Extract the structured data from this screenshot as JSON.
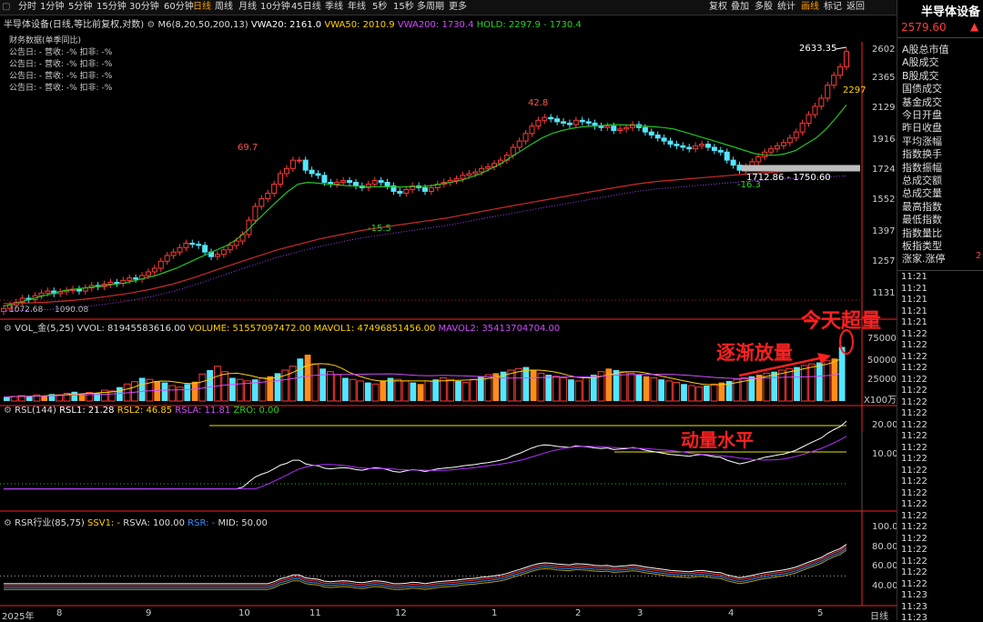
{
  "toolbar": {
    "periods": [
      "分时",
      "1分钟",
      "5分钟",
      "15分钟",
      "30分钟",
      "60分钟",
      "日线",
      "周线",
      "月线",
      "10分钟",
      "45日线",
      "季线",
      "年线",
      "5秒",
      "15秒",
      "多周期",
      "更多"
    ],
    "active_period": "日线",
    "right": [
      "复权",
      "叠加",
      "多股",
      "统计",
      "画线",
      "标记",
      "返回"
    ],
    "right_active": "画线"
  },
  "main_legend": {
    "name": "半导体设备(日线,等比前复权,对数)",
    "ind": "M6(8,20,50,200,13)",
    "vwa20": "VWA20: 2161.0",
    "vwa50": "VWA50: 2010.9",
    "vwa200": "VWA200: 1730.4",
    "hold": "HOLD: 2297.9 - 1730.4"
  },
  "finance": {
    "title": "财务数据(单季同比)",
    "rows": [
      "公告日: -   营收: -%   扣非: -%",
      "公告日: -   营收: -%   扣非: -%",
      "公告日: -   营收: -%   扣非: -%",
      "公告日: -   营收: -%   扣非: -%"
    ]
  },
  "price_labels": {
    "high": "2633.35",
    "range": "1712.86 - 1750.60",
    "cut": "2297",
    "p69": "69.7",
    "p428": "42.8",
    "m155": "-15.5",
    "m163": "-16.3",
    "low1": "1072.68",
    "low2": "1090.08"
  },
  "vol_legend": {
    "name": "VOL_金(5,25)",
    "vvol": "VVOL: 81945583616.00",
    "volume": "VOLUME: 51557097472.00",
    "mavol1": "MAVOL1: 47496851456.00",
    "mavol2": "MAVOL2: 35413704704.00"
  },
  "rsl_legend": {
    "name": "RSL(144)",
    "rsl1": "RSL1: 21.28",
    "rsl2": "RSL2: 46.85",
    "rsla": "RSLA: 11.81",
    "zro": "ZRO: 0.00"
  },
  "rsr_legend": {
    "name": "RSR行业(85,75)",
    "ssv1": "SSV1: -",
    "rsva": "RSVA: 100.00",
    "rsr": "RSR: -",
    "mid": "MID: 50.00"
  },
  "annotations": {
    "today": "今天超量",
    "gradual": "逐渐放量",
    "momentum": "动量水平"
  },
  "axis": {
    "price_ticks": [
      "2602",
      "2365",
      "2129",
      "1916",
      "1724",
      "1552",
      "1397",
      "1257",
      "1131"
    ],
    "vol_ticks": [
      "75000",
      "50000",
      "25000"
    ],
    "vol_unit": "X100万",
    "rsl_ticks": [
      "20.00",
      "10.00"
    ],
    "rsr_ticks": [
      "100.0",
      "80.00",
      "60.00",
      "40.00"
    ],
    "months": [
      "2025年",
      "8",
      "9",
      "10",
      "11",
      "12",
      "1",
      "2",
      "3",
      "4",
      "5"
    ],
    "bottom_right": "日线"
  },
  "sidebar": {
    "title": "半导体设备",
    "price": "2579.60",
    "price_arrow": "▲",
    "items": [
      "A股总市值",
      "A股成交",
      "B股成交",
      "国债成交",
      "基金成交",
      "今日开盘",
      "昨日收盘",
      "平均涨幅",
      "指数换手",
      "指数振幅",
      "总成交额",
      "总成交量",
      "最高指数",
      "最低指数",
      "指数量比",
      "板指类型",
      "涨家.涨停"
    ],
    "right_digit": "2",
    "times": [
      "11:21",
      "11:21",
      "11:21",
      "11:21",
      "11:21",
      "11:22",
      "11:22",
      "11:22",
      "11:22",
      "11:22",
      "11:22",
      "11:22",
      "11:22",
      "11:22",
      "11:22",
      "11:22",
      "11:22",
      "11:22",
      "11:22",
      "11:22",
      "11:22",
      "11:22",
      "11:22",
      "11:22",
      "11:22",
      "11:22",
      "11:22",
      "11:22",
      "11:23",
      "11:23",
      "11:23"
    ]
  },
  "chart_data": {
    "type": "candlestick",
    "title": "半导体设备(日线,等比前复权,对数)",
    "price_axis": {
      "scale": "log",
      "ticks": [
        2602,
        2365,
        2129,
        1916,
        1724,
        1552,
        1397,
        1257,
        1131
      ]
    },
    "months": [
      "2025年",
      "8",
      "9",
      "10",
      "11",
      "12",
      "1",
      "2",
      "3",
      "4",
      "5"
    ],
    "close_series": [
      1072,
      1085,
      1095,
      1110,
      1105,
      1120,
      1130,
      1138,
      1128,
      1135,
      1140,
      1145,
      1138,
      1150,
      1160,
      1155,
      1165,
      1172,
      1168,
      1180,
      1190,
      1185,
      1200,
      1215,
      1230,
      1260,
      1285,
      1300,
      1320,
      1340,
      1335,
      1330,
      1300,
      1280,
      1290,
      1310,
      1330,
      1350,
      1380,
      1450,
      1520,
      1560,
      1590,
      1640,
      1700,
      1730,
      1780,
      1780,
      1720,
      1700,
      1690,
      1650,
      1640,
      1650,
      1660,
      1650,
      1630,
      1620,
      1640,
      1660,
      1650,
      1630,
      1600,
      1590,
      1610,
      1630,
      1620,
      1600,
      1620,
      1640,
      1650,
      1660,
      1670,
      1690,
      1700,
      1710,
      1730,
      1740,
      1760,
      1780,
      1810,
      1860,
      1900,
      1950,
      2000,
      2040,
      2060,
      2050,
      2030,
      2020,
      2010,
      2040,
      2030,
      2020,
      2000,
      1990,
      2000,
      1970,
      1980,
      1990,
      2010,
      1990,
      1960,
      1940,
      1920,
      1900,
      1880,
      1870,
      1860,
      1850,
      1870,
      1880,
      1860,
      1840,
      1830,
      1780,
      1750,
      1720,
      1740,
      1770,
      1800,
      1830,
      1850,
      1870,
      1890,
      1920,
      1960,
      2020,
      2080,
      2140,
      2200,
      2300,
      2380,
      2450,
      2580
    ],
    "vwa20": [
      1080,
      1090,
      1100,
      1110,
      1120,
      1130,
      1140,
      1145,
      1150,
      1155,
      1160,
      1165,
      1170,
      1180,
      1190,
      1200,
      1215,
      1230,
      1250,
      1270,
      1290,
      1310,
      1330,
      1360,
      1400,
      1450,
      1500,
      1550,
      1600,
      1640,
      1650,
      1645,
      1640,
      1635,
      1630,
      1628,
      1626,
      1625,
      1625,
      1624,
      1625,
      1626,
      1630,
      1640,
      1650,
      1660,
      1680,
      1700,
      1730,
      1760,
      1800,
      1840,
      1880,
      1920,
      1950,
      1970,
      1985,
      1995,
      2000,
      2005,
      2010,
      2008,
      2005,
      2000,
      1995,
      1990,
      1980,
      1960,
      1940,
      1920,
      1900,
      1880,
      1860,
      1840,
      1820,
      1810,
      1810,
      1820,
      1840,
      1880,
      1920,
      1980,
      2060,
      2150
    ],
    "vwa200": [
      1090,
      1092,
      1095,
      1100,
      1108,
      1118,
      1130,
      1145,
      1165,
      1190,
      1220,
      1250,
      1280,
      1310,
      1335,
      1360,
      1380,
      1400,
      1415,
      1430,
      1445,
      1460,
      1480,
      1500,
      1520,
      1540,
      1560,
      1580,
      1600,
      1620,
      1640,
      1655,
      1665,
      1675,
      1685,
      1695,
      1705,
      1712,
      1718,
      1724,
      1730
    ],
    "hold": [
      1712.86,
      1750.6
    ],
    "volume_axis": {
      "ticks": [
        75000,
        50000,
        25000
      ],
      "unit": "X100万"
    },
    "volume_bars": [
      5,
      6,
      7,
      6,
      8,
      7,
      9,
      8,
      10,
      12,
      9,
      11,
      10,
      14,
      13,
      18,
      22,
      25,
      30,
      28,
      26,
      24,
      20,
      18,
      22,
      25,
      35,
      40,
      45,
      38,
      30,
      28,
      26,
      28,
      30,
      32,
      36,
      40,
      45,
      55,
      60,
      48,
      42,
      38,
      34,
      30,
      28,
      26,
      24,
      22,
      26,
      30,
      28,
      26,
      24,
      22,
      26,
      28,
      30,
      28,
      26,
      24,
      28,
      32,
      34,
      36,
      38,
      40,
      42,
      44,
      40,
      36,
      34,
      32,
      30,
      28,
      26,
      30,
      34,
      38,
      42,
      40,
      38,
      36,
      34,
      32,
      30,
      28,
      26,
      24,
      22,
      20,
      18,
      20,
      22,
      24,
      26,
      28,
      30,
      32,
      34,
      36,
      38,
      40,
      42,
      44,
      46,
      48,
      50,
      52,
      55,
      70
    ],
    "rsl": {
      "ticks": [
        20.0,
        10.0
      ],
      "rsl1": 21.28,
      "rsl2": 46.85,
      "rsla": 11.81,
      "zro": 0.0
    },
    "rsr": {
      "ticks": [
        100.0,
        80.0,
        60.0,
        40.0
      ],
      "rsva": 100.0,
      "mid": 50.0
    }
  }
}
